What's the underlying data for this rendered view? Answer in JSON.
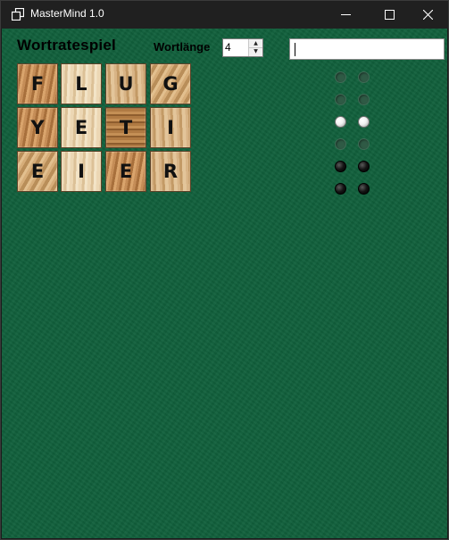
{
  "window": {
    "title": "MasterMind 1.0",
    "controls": {
      "minimize_icon": "minimize-icon",
      "maximize_icon": "maximize-icon",
      "close_icon": "close-icon"
    }
  },
  "header": {
    "title": "Wortratespiel",
    "length_label": "Wortlänge",
    "length_value": "4",
    "guess_input_value": ""
  },
  "board": {
    "rows": [
      {
        "letters": [
          "F",
          "L",
          "U",
          "G"
        ],
        "pegs": [
          "empty",
          "empty"
        ]
      },
      {
        "letters": [
          "Y",
          "E",
          "T",
          "I"
        ],
        "pegs": [
          "empty",
          "empty"
        ]
      },
      {
        "letters": [
          "E",
          "I",
          "E",
          "R"
        ],
        "pegs": [
          "white",
          "white"
        ]
      },
      {
        "pegs": [
          "empty",
          "empty"
        ]
      },
      {
        "pegs": [
          "black",
          "black"
        ]
      },
      {
        "pegs": [
          "black",
          "black"
        ]
      }
    ]
  },
  "colors": {
    "table_green": "#11603c",
    "titlebar": "#202020"
  }
}
